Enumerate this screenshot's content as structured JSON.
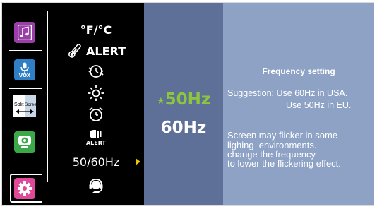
{
  "modes": [
    {
      "name": "music",
      "color": "#9a3ea8"
    },
    {
      "name": "vox",
      "label": "VOX",
      "color": "#2f7fc6"
    },
    {
      "name": "split-screen",
      "label_left": "Split",
      "label_right": "Screen",
      "color": "#ffffff"
    },
    {
      "name": "webcam",
      "color": "#3ba84a"
    },
    {
      "name": "settings",
      "color": "#e0489a"
    }
  ],
  "settings": {
    "temp_unit": "°F/°C",
    "alert": "ALERT",
    "vibration_alert": "ALERT",
    "frequency": "50/60Hz"
  },
  "values": {
    "selected_marker": "★",
    "option_50": "50Hz",
    "option_60": "60Hz",
    "selected_color": "#8cc63f"
  },
  "description": {
    "title": "Frequency setting",
    "suggestion_line1": "Suggestion: Use 60Hz in USA.",
    "suggestion_line2": "Use 50Hz in EU.",
    "note_lines": [
      "Screen may flicker in some",
      "lighing  environments.",
      "change the frequency",
      "to lower the flickering effect."
    ]
  }
}
